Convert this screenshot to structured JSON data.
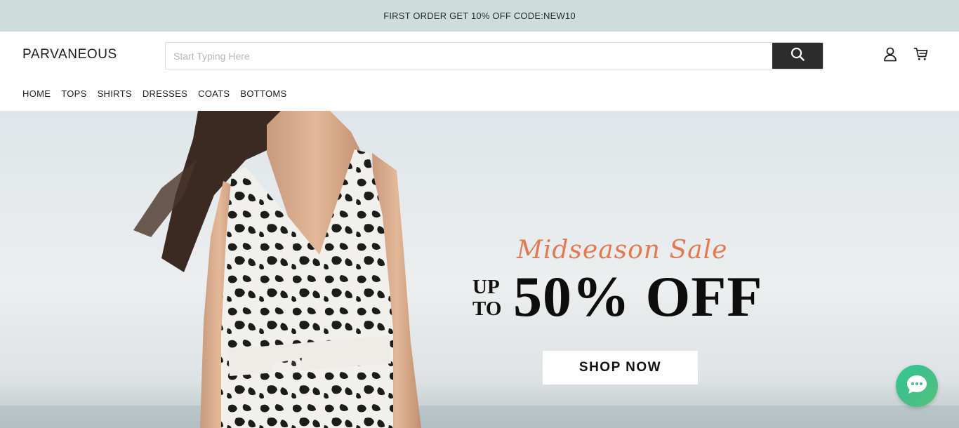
{
  "announcement": {
    "text": "FIRST ORDER GET 10% OFF CODE:NEW10"
  },
  "header": {
    "logo": "PARVANEOUS",
    "search": {
      "placeholder": "Start Typing Here",
      "value": ""
    },
    "icons": {
      "search": "search-icon",
      "account": "user-icon",
      "cart": "cart-icon"
    }
  },
  "nav": {
    "items": [
      {
        "label": "HOME"
      },
      {
        "label": "TOPS"
      },
      {
        "label": "SHIRTS"
      },
      {
        "label": "DRESSES"
      },
      {
        "label": "COATS"
      },
      {
        "label": "BOTTOMS"
      }
    ]
  },
  "hero": {
    "script_title": "Midseason Sale",
    "up_line1": "UP",
    "up_line2": "TO",
    "headline": "50% OFF",
    "cta": "SHOP NOW"
  },
  "chat": {
    "icon": "chat-bubble-icon"
  },
  "colors": {
    "announcement_bg": "#cddddc",
    "search_button": "#2c2c2c",
    "script_accent": "#e4784e",
    "chat_gradient_start": "#2ecc8f",
    "chat_gradient_end": "#55c27a"
  }
}
